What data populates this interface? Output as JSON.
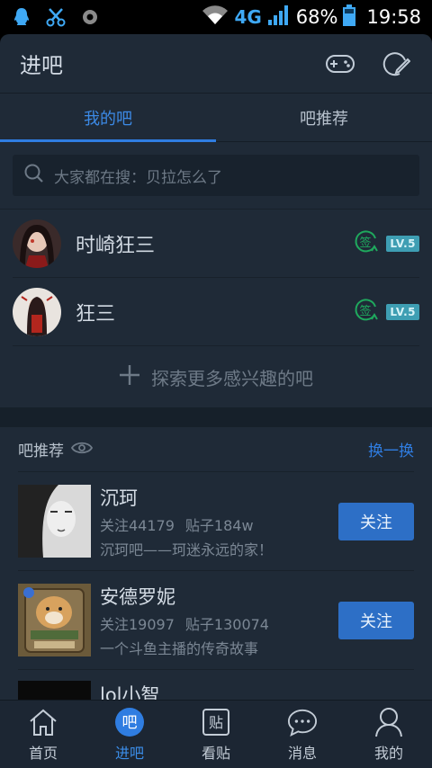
{
  "status_bar": {
    "network": "4G",
    "battery": "68%",
    "time": "19:58"
  },
  "header": {
    "title": "进吧"
  },
  "tabs": [
    {
      "label": "我的吧",
      "active": true
    },
    {
      "label": "吧推荐",
      "active": false
    }
  ],
  "search": {
    "placeholder": "大家都在搜：贝拉怎么了"
  },
  "my_bars": [
    {
      "name": "时崎狂三",
      "sign_icon": "sign-in-icon",
      "level": "LV.5"
    },
    {
      "name": "狂三",
      "sign_icon": "sign-in-icon",
      "level": "LV.5"
    }
  ],
  "explore": {
    "label": "探索更多感兴趣的吧"
  },
  "recommend": {
    "title": "吧推荐",
    "refresh": "换一换",
    "items": [
      {
        "name": "沉珂",
        "followers": "关注44179",
        "posts": "贴子184w",
        "desc": "沉珂吧——珂迷永远的家！",
        "follow": "关注"
      },
      {
        "name": "安德罗妮",
        "followers": "关注19097",
        "posts": "贴子130074",
        "desc": "一个斗鱼主播的传奇故事",
        "follow": "关注"
      },
      {
        "name": "lol小智"
      }
    ]
  },
  "bottom_nav": [
    {
      "label": "首页",
      "icon": "home-icon",
      "active": false
    },
    {
      "label": "进吧",
      "icon": "bar-icon",
      "icon_text": "吧",
      "active": true
    },
    {
      "label": "看贴",
      "icon": "post-icon",
      "icon_text": "贴",
      "active": false
    },
    {
      "label": "消息",
      "icon": "message-icon",
      "active": false
    },
    {
      "label": "我的",
      "icon": "profile-icon",
      "active": false
    }
  ],
  "colors": {
    "accent": "#2f7de1",
    "background": "#1f2a37",
    "level_badge": "#3e9eb3",
    "sign_icon": "#1fa85d"
  }
}
